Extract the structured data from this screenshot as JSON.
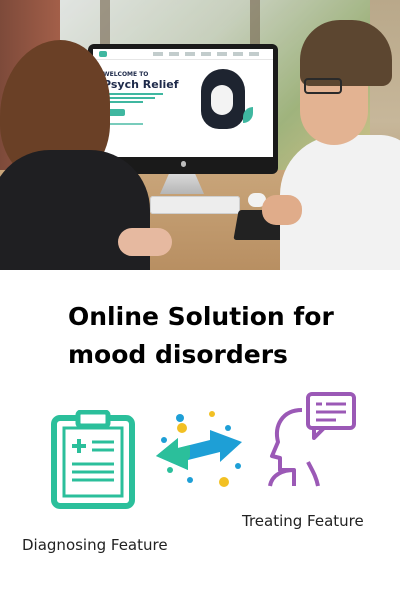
{
  "screen": {
    "welcome": "WELCOME TO",
    "brand": "Psych Relief"
  },
  "heading": {
    "line1": "Online Solution for",
    "line2": "mood disorders"
  },
  "features": [
    {
      "label": "Diagnosing Feature",
      "icon": "clipboard-icon"
    },
    {
      "label": "Treating Feature",
      "icon": "head-speech-icon"
    }
  ],
  "connector_icon": "double-arrow-icon",
  "colors": {
    "teal": "#2bbf9b",
    "blue": "#1e9fd6",
    "purple": "#9b59b6",
    "gold": "#f2c023"
  }
}
